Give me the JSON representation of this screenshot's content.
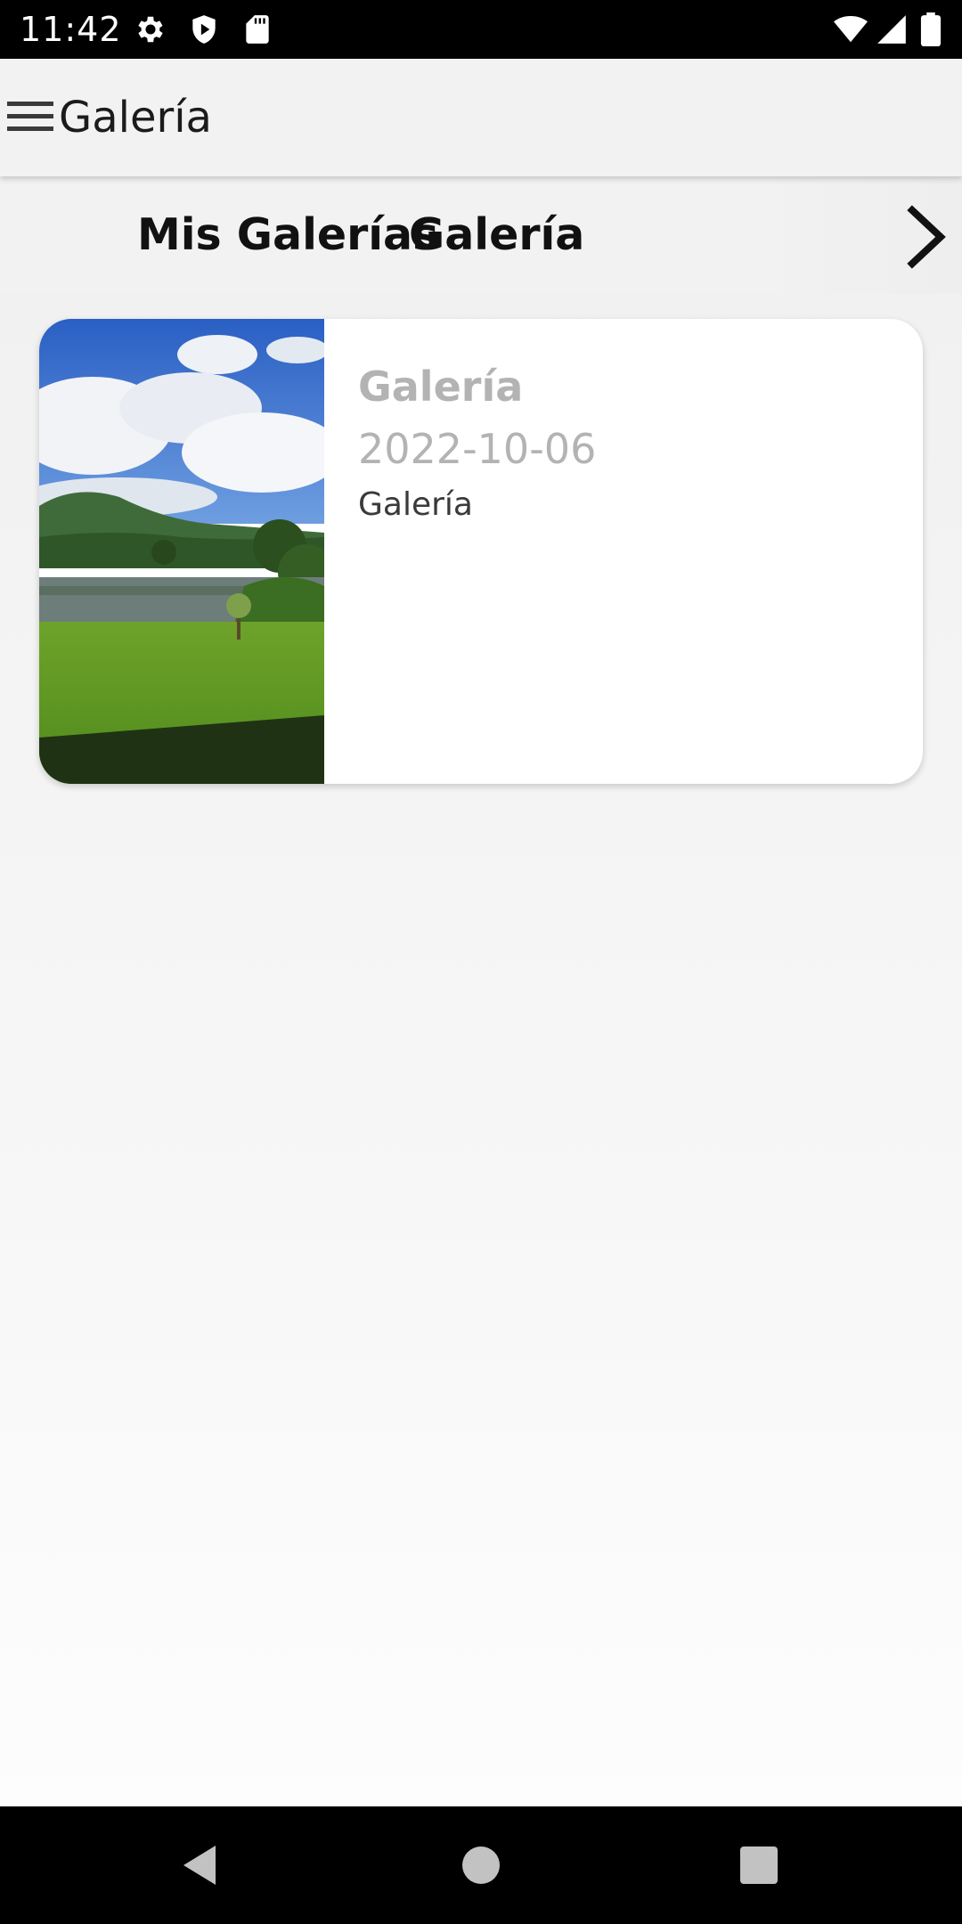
{
  "status_bar": {
    "time": "11:42",
    "icons": [
      "settings-gear-icon",
      "shield-play-icon",
      "sd-card-icon",
      "wifi-icon",
      "cell-signal-icon",
      "battery-icon"
    ]
  },
  "app_bar": {
    "title": "Galería",
    "menu_icon": "hamburger-menu-icon"
  },
  "tabs": {
    "items": [
      {
        "label": "Mis Galerías"
      },
      {
        "label": "Galería"
      }
    ],
    "next_icon": "chevron-right-icon"
  },
  "gallery_list": [
    {
      "title": "Galería",
      "date": "2022-10-06",
      "description": "Galería",
      "image": "landscape-photo"
    }
  ],
  "nav_bar": {
    "buttons": [
      "back-icon",
      "home-icon",
      "recents-icon"
    ]
  },
  "colors": {
    "title_gray": "#b3b3b3",
    "app_bar_bg": "#f2f2f2",
    "system_bar_bg": "#000000"
  }
}
